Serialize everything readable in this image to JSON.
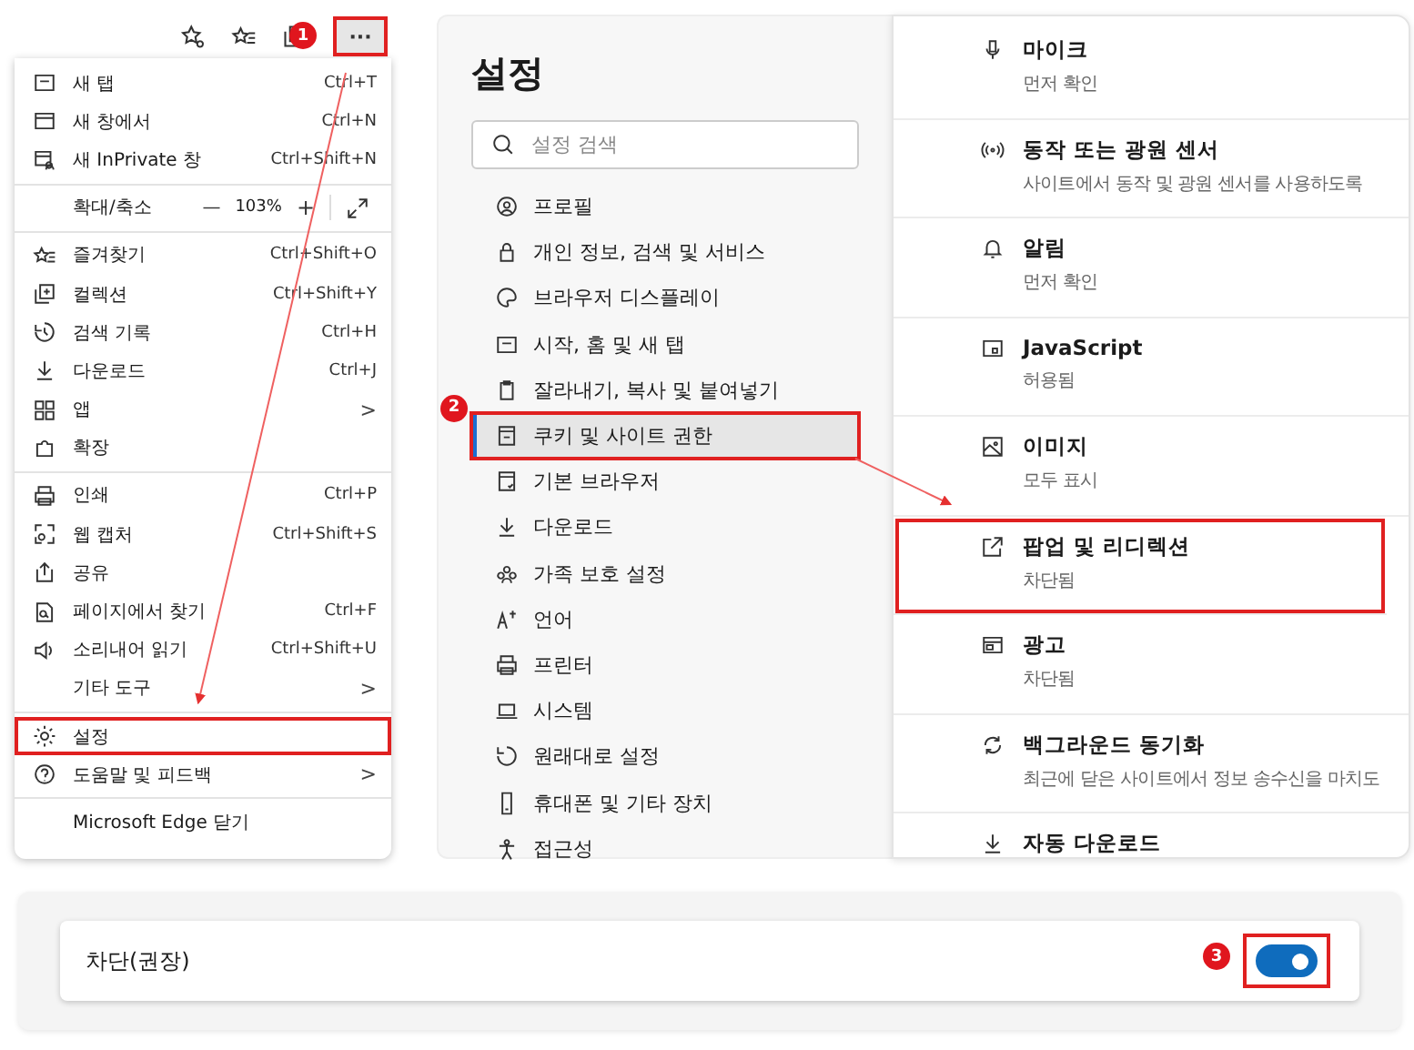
{
  "toolbar": {
    "more_button": {
      "label": "···",
      "highlighted": true,
      "step": "1"
    }
  },
  "menu": {
    "sections": [
      {
        "items": [
          {
            "kind": "item",
            "label": "새 탭",
            "shortcut": "Ctrl+T",
            "highlighted": false
          },
          {
            "kind": "item",
            "label": "새 창에서",
            "shortcut": "Ctrl+N",
            "highlighted": false
          },
          {
            "kind": "item",
            "label": "새 InPrivate 창",
            "shortcut": "Ctrl+Shift+N",
            "highlighted": false
          }
        ]
      },
      {
        "items": [
          {
            "kind": "zoom",
            "label": "확대/축소",
            "minus": "—",
            "value": "103%",
            "plus": "+"
          }
        ]
      },
      {
        "items": [
          {
            "kind": "item",
            "label": "즐겨찾기",
            "shortcut": "Ctrl+Shift+O",
            "highlighted": false
          },
          {
            "kind": "item",
            "label": "컬렉션",
            "shortcut": "Ctrl+Shift+Y",
            "highlighted": false
          },
          {
            "kind": "item",
            "label": "검색 기록",
            "shortcut": "Ctrl+H",
            "highlighted": false
          },
          {
            "kind": "item",
            "label": "다운로드",
            "shortcut": "Ctrl+J",
            "highlighted": false
          },
          {
            "kind": "item",
            "label": "앱",
            "submenu": ">",
            "highlighted": false
          },
          {
            "kind": "item",
            "label": "확장",
            "highlighted": false
          }
        ]
      },
      {
        "items": [
          {
            "kind": "item",
            "label": "인쇄",
            "shortcut": "Ctrl+P",
            "highlighted": false
          },
          {
            "kind": "item",
            "label": "웹 캡처",
            "shortcut": "Ctrl+Shift+S",
            "highlighted": false
          },
          {
            "kind": "item",
            "label": "공유",
            "highlighted": false
          },
          {
            "kind": "item",
            "label": "페이지에서 찾기",
            "shortcut": "Ctrl+F",
            "highlighted": false
          },
          {
            "kind": "item",
            "label": "소리내어 읽기",
            "shortcut": "Ctrl+Shift+U",
            "highlighted": false
          },
          {
            "kind": "item",
            "label": "기타 도구",
            "submenu": ">",
            "highlighted": false
          }
        ]
      },
      {
        "items": [
          {
            "kind": "item",
            "label": "설정",
            "highlighted": true
          },
          {
            "kind": "item",
            "label": "도움말 및 피드백",
            "submenu": ">",
            "highlighted": false
          }
        ]
      },
      {
        "items": [
          {
            "kind": "item",
            "label": "Microsoft Edge 닫기",
            "highlighted": false
          }
        ]
      }
    ]
  },
  "settings": {
    "title": "설정",
    "search": {
      "placeholder": "설정 검색"
    },
    "nav": [
      {
        "label": "프로필",
        "selected": false,
        "highlighted": false
      },
      {
        "label": "개인 정보, 검색 및 서비스",
        "selected": false,
        "highlighted": false
      },
      {
        "label": "브라우저 디스플레이",
        "selected": false,
        "highlighted": false
      },
      {
        "label": "시작, 홈 및 새 탭",
        "selected": false,
        "highlighted": false
      },
      {
        "label": "잘라내기, 복사 및 붙여넣기",
        "selected": false,
        "highlighted": false
      },
      {
        "label": "쿠키 및 사이트 권한",
        "selected": true,
        "highlighted": true,
        "step": "2"
      },
      {
        "label": "기본 브라우저",
        "selected": false,
        "highlighted": false
      },
      {
        "label": "다운로드",
        "selected": false,
        "highlighted": false
      },
      {
        "label": "가족 보호 설정",
        "selected": false,
        "highlighted": false
      },
      {
        "label": "언어",
        "selected": false,
        "highlighted": false
      },
      {
        "label": "프린터",
        "selected": false,
        "highlighted": false
      },
      {
        "label": "시스템",
        "selected": false,
        "highlighted": false
      },
      {
        "label": "원래대로 설정",
        "selected": false,
        "highlighted": false
      },
      {
        "label": "휴대폰 및 기타 장치",
        "selected": false,
        "highlighted": false
      },
      {
        "label": "접근성",
        "selected": false,
        "highlighted": false
      }
    ]
  },
  "permissions": [
    {
      "title": "마이크",
      "subtitle": "먼저 확인",
      "highlighted": false
    },
    {
      "title": "동작 또는 광원 센서",
      "subtitle": "사이트에서 동작 및 광원 센서를 사용하도록",
      "highlighted": false
    },
    {
      "title": "알림",
      "subtitle": "먼저 확인",
      "highlighted": false
    },
    {
      "title": "JavaScript",
      "subtitle": "허용됨",
      "highlighted": false
    },
    {
      "title": "이미지",
      "subtitle": "모두 표시",
      "highlighted": false
    },
    {
      "title": "팝업 및 리디렉션",
      "subtitle": "차단됨",
      "highlighted": true
    },
    {
      "title": "광고",
      "subtitle": "차단됨",
      "highlighted": false
    },
    {
      "title": "백그라운드 동기화",
      "subtitle": "최근에 닫은 사이트에서 정보 송수신을 마치도",
      "highlighted": false
    },
    {
      "title": "자동 다운로드",
      "highlighted": false
    }
  ],
  "popup_setting": {
    "label": "차단(권장)",
    "toggle": {
      "on": true,
      "highlighted": true,
      "step": "3"
    }
  }
}
